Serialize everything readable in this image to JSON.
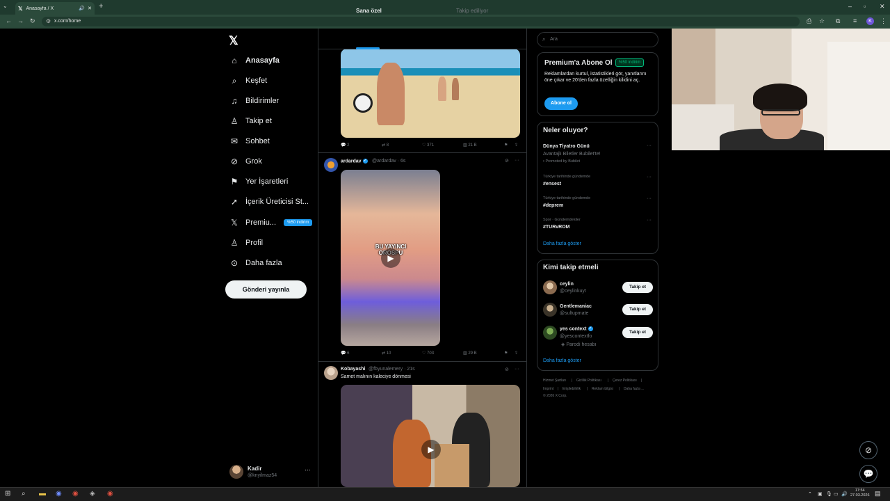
{
  "browser": {
    "tab_title": "Anasayfa / X",
    "url": "x.com/home"
  },
  "nav": {
    "items": [
      {
        "label": "Anasayfa",
        "icon": "home-icon",
        "glyph": "⌂"
      },
      {
        "label": "Keşfet",
        "icon": "search-icon",
        "glyph": "⌕"
      },
      {
        "label": "Bildirimler",
        "icon": "bell-icon",
        "glyph": "♫"
      },
      {
        "label": "Takip et",
        "icon": "person-add-icon",
        "glyph": "♙"
      },
      {
        "label": "Sohbet",
        "icon": "mail-icon",
        "glyph": "✉"
      },
      {
        "label": "Grok",
        "icon": "grok-icon",
        "glyph": "⊘"
      },
      {
        "label": "Yer İşaretleri",
        "icon": "bookmark-icon",
        "glyph": "⚑"
      },
      {
        "label": "İçerik Üreticisi St...",
        "icon": "rocket-icon",
        "glyph": "➚"
      },
      {
        "label": "Premiu...",
        "icon": "x-premium-icon",
        "glyph": "𝕏"
      },
      {
        "label": "Profil",
        "icon": "profile-icon",
        "glyph": "♙"
      },
      {
        "label": "Daha fazla",
        "icon": "more-circle-icon",
        "glyph": "⊙"
      }
    ],
    "premium_badge": "%50 indirim",
    "post_button": "Gönderi yayınla",
    "account_name": "Kadir",
    "account_handle": "@knyilmaz54"
  },
  "feed": {
    "tabs": [
      "Sana özel",
      "Takip ediliyor"
    ],
    "post1": {
      "replies": "2",
      "reposts": "8",
      "likes": "371",
      "views": "21 B"
    },
    "post2": {
      "name": "ardardav",
      "handle": "@ardardav",
      "time": "6s",
      "overlay": "BU YAYINCI OROSPU",
      "replies": "6",
      "reposts": "10",
      "likes": "703",
      "views": "29 B"
    },
    "post3": {
      "name": "Kobayashi",
      "handle": "@fbyunalemery",
      "time": "21s",
      "text": "Samet malının kaleciye dönmesi"
    }
  },
  "sidebar": {
    "search_placeholder": "Ara",
    "premium": {
      "title": "Premium'a Abone Ol",
      "badge": "%50 indirim",
      "desc": "Reklamlardan kurtul, istatistikleri gör, yanıtlarını öne çıkar ve 20'den fazla özelliğin kilidini aç.",
      "button": "Abone ol"
    },
    "trends": {
      "title": "Neler oluyor?",
      "items": [
        {
          "meta": "",
          "name": "Dünya Tiyatro Günü",
          "sub": "Avantajlı Biletler Bubilet'te!",
          "promo": "Promoted by Bubilet"
        },
        {
          "meta": "Türkiye tarihinde gündemde",
          "name": "#ensest"
        },
        {
          "meta": "Türkiye tarihinde gündemde",
          "name": "#deprem"
        },
        {
          "meta": "Spor · Gündemdekiler",
          "name": "#TURvROM"
        }
      ],
      "more": "Daha fazla göster"
    },
    "follow": {
      "title": "Kimi takip etmeli",
      "items": [
        {
          "name": "ceylin",
          "handle": "@ceylinkuyt",
          "btn": "Takip et"
        },
        {
          "name": "Gentlemaniac",
          "handle": "@sultupmate",
          "btn": "Takip et"
        },
        {
          "name": "yes context",
          "handle": "@yescontextfo",
          "extra": "Parodi hesabı",
          "btn": "Takip et"
        }
      ],
      "more": "Daha fazla göster"
    },
    "footer": {
      "l1": [
        "Hizmet Şartları",
        "Gizlilik Politikası",
        "Çerez Politikası"
      ],
      "l2": [
        "Imprint",
        "Erişilebilirlik",
        "Reklam bilgisi",
        "Daha fazla ..."
      ],
      "copy": "© 2026 X Corp."
    }
  },
  "taskbar": {
    "time": "17:54",
    "date": "27.03.2026"
  }
}
